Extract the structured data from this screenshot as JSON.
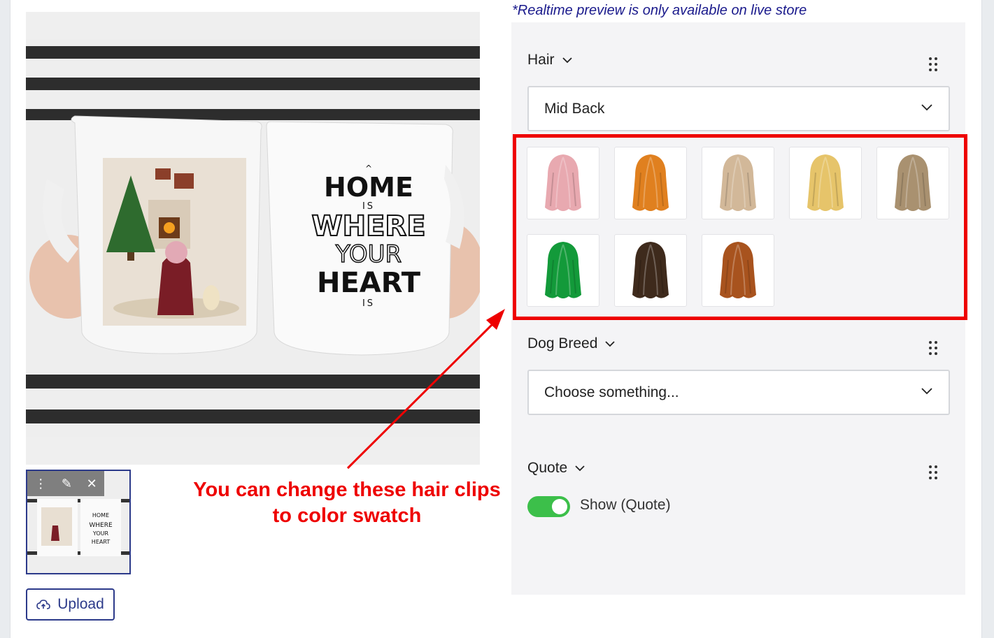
{
  "notice": "*Realtime preview is only available on live store",
  "mug_text": {
    "home": "HOME",
    "is1": "IS",
    "where": "WHERE",
    "your": "YOUR",
    "heart": "HEART",
    "is2": "IS"
  },
  "upload": {
    "label": "Upload",
    "icon": "cloud-upload-icon"
  },
  "hair": {
    "title": "Hair",
    "selected": "Mid Back",
    "swatches": [
      {
        "name": "pink",
        "color": "#e8a9b0"
      },
      {
        "name": "ginger",
        "color": "#e0801f"
      },
      {
        "name": "ash blonde",
        "color": "#d2b899"
      },
      {
        "name": "golden blonde",
        "color": "#e6c46a"
      },
      {
        "name": "dark blonde",
        "color": "#a99170"
      },
      {
        "name": "green",
        "color": "#139a3a"
      },
      {
        "name": "dark brown",
        "color": "#3e2a1c"
      },
      {
        "name": "auburn",
        "color": "#a8531e"
      }
    ]
  },
  "dog_breed": {
    "title": "Dog Breed",
    "placeholder": "Choose something..."
  },
  "quote": {
    "title": "Quote",
    "toggle_label": "Show (Quote)",
    "toggle_on": true
  },
  "annotation": {
    "line1": "You can change these hair clips",
    "line2": "to color swatch"
  },
  "colors": {
    "accent": "#2c3a8a",
    "highlight": "#ee0000",
    "toggle": "#3cbf4a",
    "notice": "#1a1a8c"
  }
}
